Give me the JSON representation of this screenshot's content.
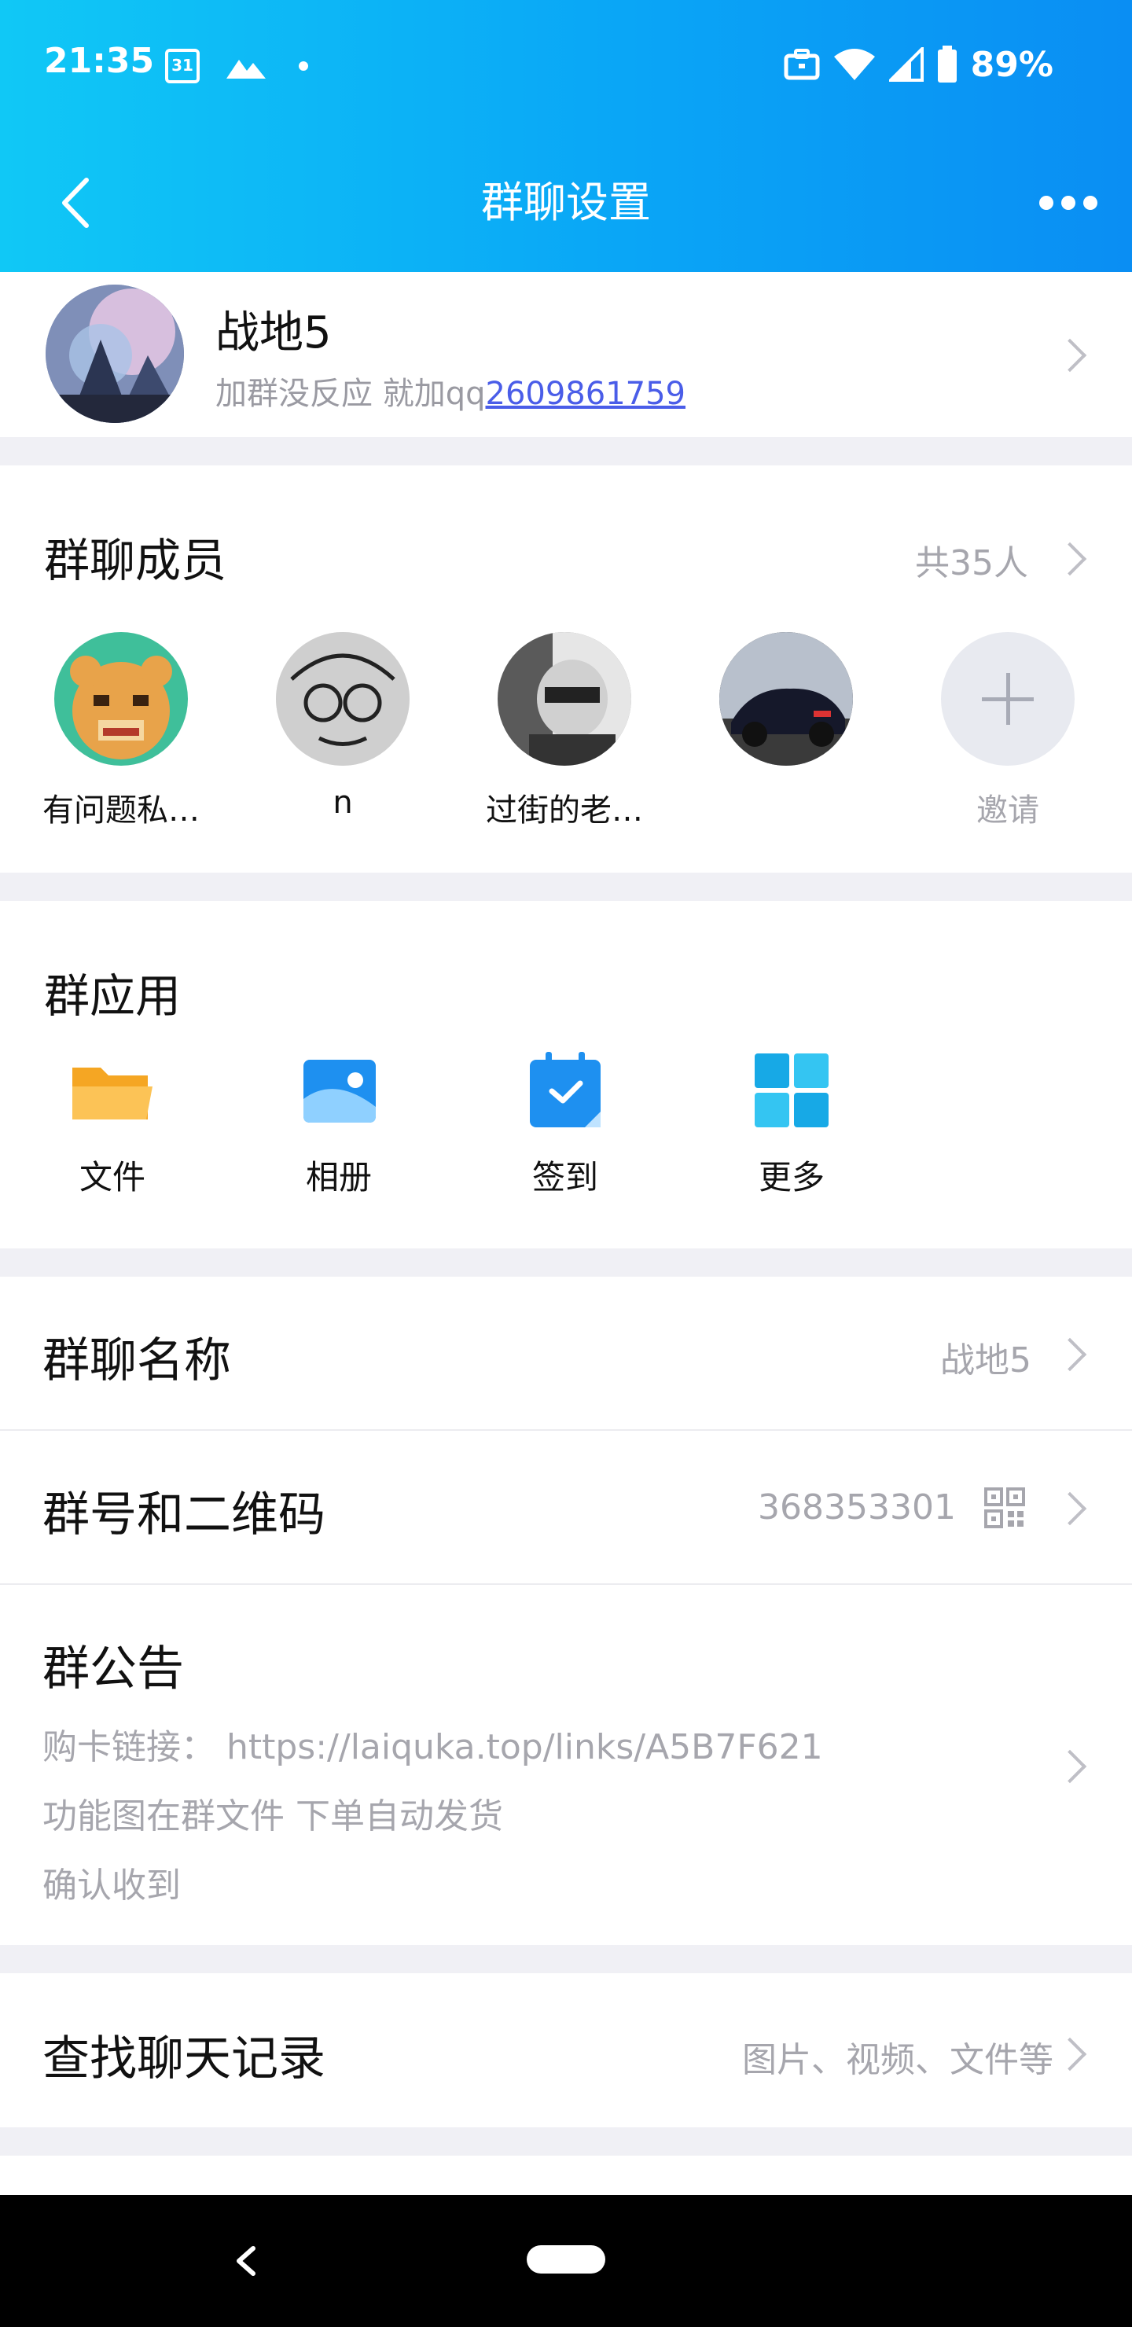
{
  "status_bar": {
    "time": "21:35",
    "calendar_day": "31",
    "battery": "89%"
  },
  "nav": {
    "title": "群聊设置"
  },
  "group": {
    "name": "战地5",
    "desc_prefix": "加群没反应 就加qq",
    "desc_link": "2609861759"
  },
  "members": {
    "title": "群聊成员",
    "count": "共35人",
    "items": [
      {
        "name": "有问题私…"
      },
      {
        "name": "n"
      },
      {
        "name": "过街的老…"
      },
      {
        "name": ""
      },
      {
        "name": "邀请"
      }
    ]
  },
  "apps": {
    "title": "群应用",
    "items": [
      {
        "label": "文件",
        "icon": "folder-icon"
      },
      {
        "label": "相册",
        "icon": "photo-album-icon"
      },
      {
        "label": "签到",
        "icon": "check-in-calendar-icon"
      },
      {
        "label": "更多",
        "icon": "more-grid-icon"
      }
    ]
  },
  "rows": {
    "group_name": {
      "label": "群聊名称",
      "value": "战地5"
    },
    "group_number": {
      "label": "群号和二维码",
      "value": "368353301"
    },
    "announcement": {
      "label": "群公告",
      "lines": [
        "购卡链接： https://laiquka.top/links/A5B7F621",
        "功能图在群文件 下单自动发货",
        "确认收到"
      ]
    },
    "search_history": {
      "label": "查找聊天记录",
      "value": "图片、视频、文件等"
    }
  },
  "colors": {
    "header_start": "#10c8f6",
    "header_end": "#0a8ef3",
    "link": "#4a5de8",
    "secondary_text": "#a6a6ad"
  }
}
